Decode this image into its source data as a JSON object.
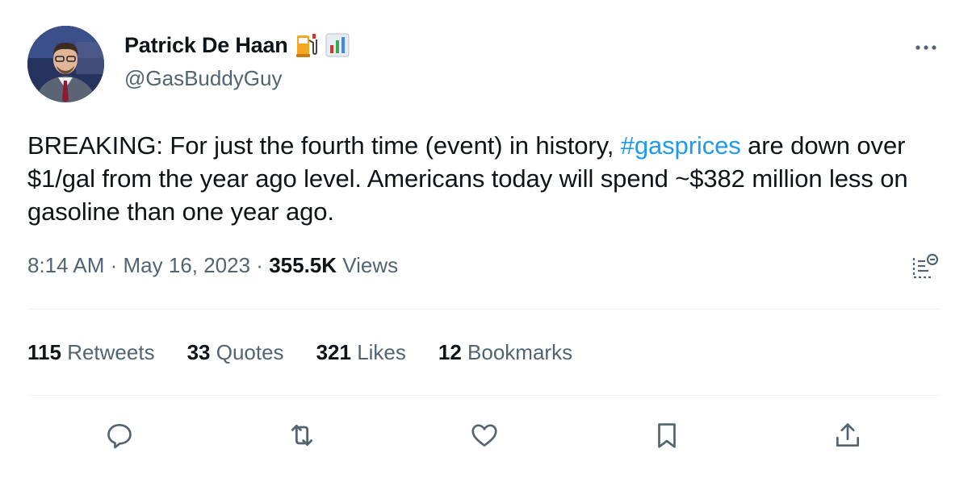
{
  "author": {
    "display_name": "Patrick De Haan",
    "handle": "@GasBuddyGuy",
    "emojis": [
      "fuel-pump-icon",
      "bar-chart-icon"
    ]
  },
  "tweet": {
    "text_before": "BREAKING: For just the fourth time (event) in history, ",
    "hashtag": "#gasprices",
    "text_after": " are down over $1/gal from the year ago level. Americans today will spend ~$382 million less on gasoline than one year ago."
  },
  "meta": {
    "time": "8:14 AM",
    "sep1": " · ",
    "date": "May 16, 2023",
    "sep2": " · ",
    "views_count": "355.5K",
    "views_label": " Views"
  },
  "stats": [
    {
      "count": "115",
      "label": "Retweets"
    },
    {
      "count": "33",
      "label": "Quotes"
    },
    {
      "count": "321",
      "label": "Likes"
    },
    {
      "count": "12",
      "label": "Bookmarks"
    }
  ],
  "actions": [
    "reply-icon",
    "retweet-icon",
    "like-icon",
    "bookmark-icon",
    "share-icon"
  ],
  "colors": {
    "text": "#0f1419",
    "secondary": "#536471",
    "link": "#1d9bf0",
    "divider": "#eff3f4"
  }
}
